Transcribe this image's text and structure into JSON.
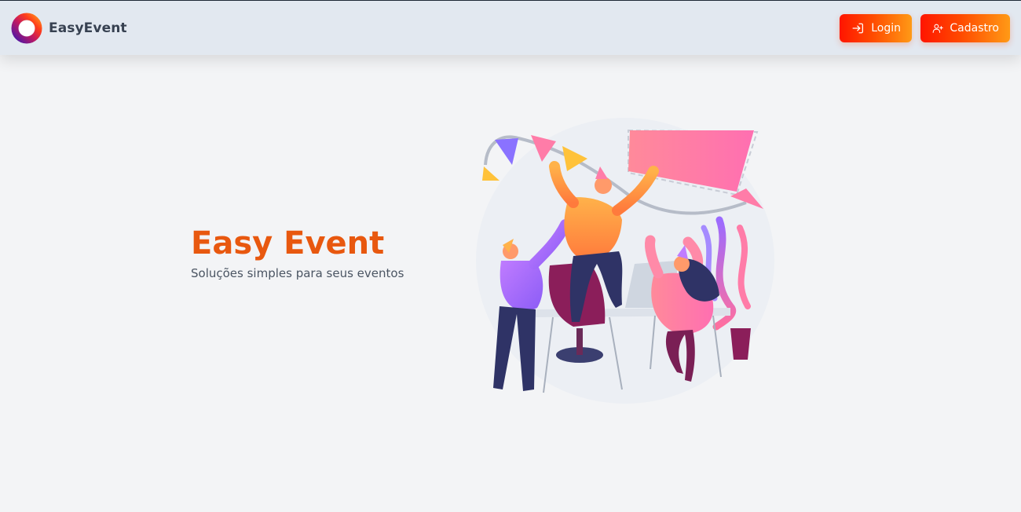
{
  "brand": {
    "name": "EasyEvent",
    "logo_icon": "ring-logo-icon"
  },
  "nav": {
    "login_label": "Login",
    "login_icon": "login-arrow-icon",
    "signup_label": "Cadastro",
    "signup_icon": "user-plus-icon"
  },
  "hero": {
    "title": "Easy Event",
    "subtitle": "Soluções simples para seus eventos"
  },
  "colors": {
    "accent_orange": "#e8580f",
    "button_gradient_start": "#ff1500",
    "button_gradient_end": "#ff9a16",
    "navbar_bg": "#e2e8f0",
    "page_bg": "#f3f4f6"
  },
  "illustration": {
    "icon": "party-illustration"
  }
}
